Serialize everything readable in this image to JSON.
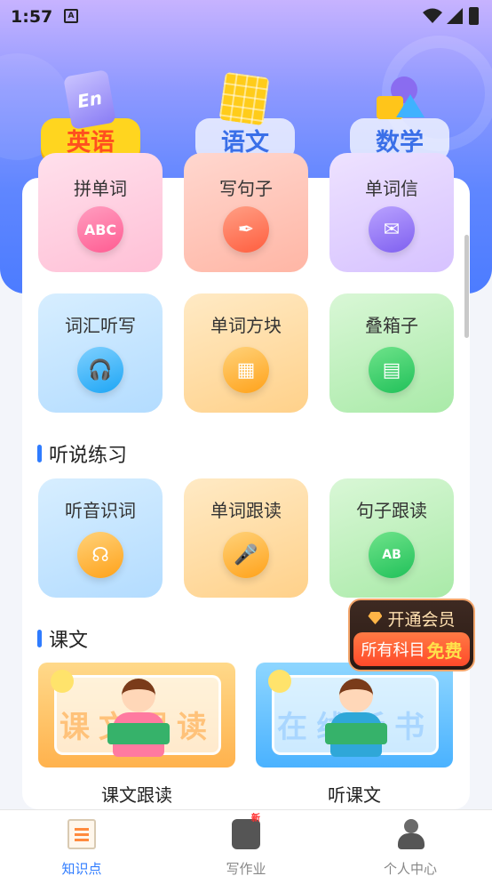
{
  "status_bar": {
    "time": "1:57",
    "app_indicator": "A"
  },
  "subjects": [
    {
      "label": "英语",
      "active": true
    },
    {
      "label": "语文",
      "active": false
    },
    {
      "label": "数学",
      "active": false
    }
  ],
  "vocab_cards": [
    {
      "label": "拼单词",
      "icon": "abc-icon"
    },
    {
      "label": "写句子",
      "icon": "pen-nib-icon"
    },
    {
      "label": "单词信",
      "icon": "envelope-icon"
    },
    {
      "label": "词汇听写",
      "icon": "headphones-icon"
    },
    {
      "label": "单词方块",
      "icon": "blocks-icon"
    },
    {
      "label": "叠箱子",
      "icon": "crate-icon"
    }
  ],
  "listening_section": {
    "title": "听说练习",
    "cards": [
      {
        "label": "听音识词",
        "icon": "headset-icon"
      },
      {
        "label": "单词跟读",
        "icon": "microphone-icon"
      },
      {
        "label": "句子跟读",
        "icon": "ab-speaker-icon"
      }
    ]
  },
  "lesson_section": {
    "title": "课文",
    "items": [
      {
        "label": "课文跟读",
        "board_text": "课文跟读"
      },
      {
        "label": "听课文",
        "board_text": "在线听书"
      }
    ]
  },
  "vip_badge": {
    "line1": "开通会员",
    "line2": "所有科目",
    "free": "免费"
  },
  "tabs": [
    {
      "label": "知识点",
      "active": true,
      "icon": "notebook-icon"
    },
    {
      "label": "写作业",
      "active": false,
      "icon": "homework-machine-icon",
      "badge": "新"
    },
    {
      "label": "个人中心",
      "active": false,
      "icon": "user-icon"
    }
  ],
  "colors": {
    "accent": "#2f7cff",
    "subject_active": "#ffd51f",
    "subject_active_text": "#ff4f1f"
  }
}
